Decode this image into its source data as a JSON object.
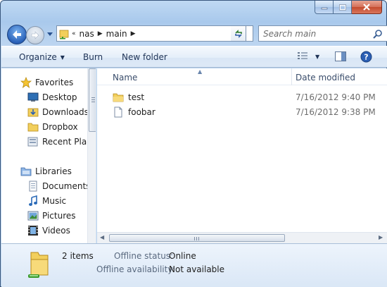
{
  "window": {
    "caption_buttons": [
      "minimize",
      "maximize",
      "close"
    ]
  },
  "nav": {
    "back_icon": "back-arrow-icon",
    "forward_icon": "forward-arrow-icon"
  },
  "address": {
    "overflow": "«",
    "crumbs": [
      "nas",
      "main"
    ]
  },
  "search": {
    "placeholder": "Search main"
  },
  "toolbar": {
    "organize": "Organize",
    "burn": "Burn",
    "new_folder": "New folder"
  },
  "sidebar": {
    "favorites": {
      "label": "Favorites",
      "items": [
        "Desktop",
        "Downloads",
        "Dropbox",
        "Recent Places"
      ]
    },
    "libraries": {
      "label": "Libraries",
      "items": [
        "Documents",
        "Music",
        "Pictures",
        "Videos"
      ]
    }
  },
  "files": {
    "columns": [
      "Name",
      "Date modified"
    ],
    "rows": [
      {
        "name": "test",
        "date": "7/16/2012 9:40 PM",
        "type": "folder"
      },
      {
        "name": "foobar",
        "date": "7/16/2012 9:38 PM",
        "type": "file"
      }
    ]
  },
  "details": {
    "count": "2 items",
    "offline_status_label": "Offline status:",
    "offline_status_value": "Online",
    "offline_availability_label": "Offline availability:",
    "offline_availability_value": "Not available"
  },
  "colors": {
    "frame": "#bcd5f0",
    "accent": "#1e3356",
    "close": "#c44a2e"
  }
}
